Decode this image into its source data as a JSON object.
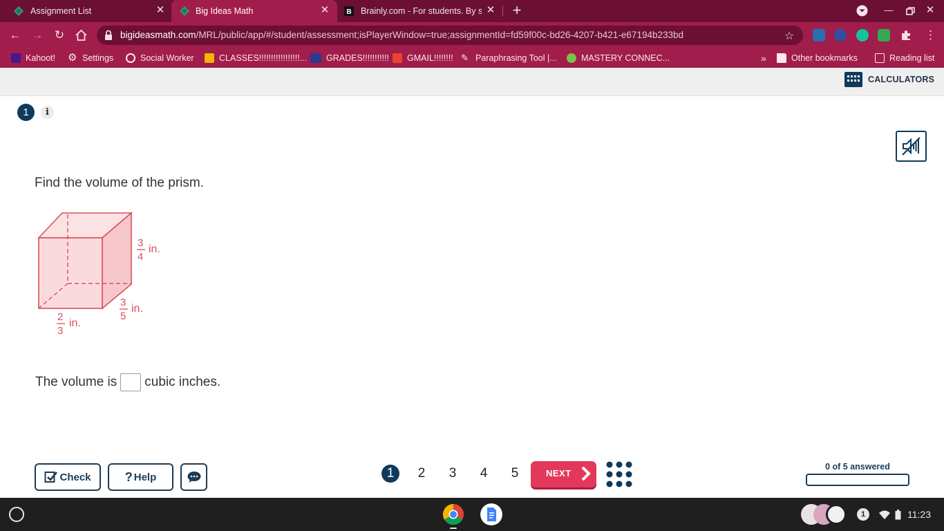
{
  "browser": {
    "tabs": [
      {
        "title": "Assignment List",
        "active": false
      },
      {
        "title": "Big Ideas Math",
        "active": true
      },
      {
        "title": "Brainly.com - For students. By st",
        "active": false
      }
    ],
    "url_host": "bigideasmath.com",
    "url_path": "/MRL/public/app/#/student/assessment;isPlayerWindow=true;assignmentId=fd59f00c-bd26-4207-b421-e67194b233bd",
    "bookmarks": [
      "Kahoot!",
      "Settings",
      "Social Worker",
      "CLASSES!!!!!!!!!!!!!!!!!...",
      "GRADES!!!!!!!!!!!",
      "GMAIL!!!!!!!!",
      "Paraphrasing Tool |...",
      "MASTERY CONNEC..."
    ],
    "other_bookmarks": "Other bookmarks",
    "reading_list": "Reading list",
    "overflow": "»"
  },
  "header": {
    "calculators_label": "CALCULATORS"
  },
  "question": {
    "number": "1",
    "info": "i",
    "prompt": "Find the volume of the prism.",
    "dims": {
      "height": {
        "num": "3",
        "den": "4",
        "unit": "in."
      },
      "depth": {
        "num": "3",
        "den": "5",
        "unit": "in."
      },
      "width": {
        "num": "2",
        "den": "3",
        "unit": "in."
      }
    },
    "answer_prefix": "The volume is",
    "answer_suffix": "cubic inches.",
    "answer_value": ""
  },
  "controls": {
    "check_label": "Check",
    "help_label": "Help",
    "pages": [
      "1",
      "2",
      "3",
      "4",
      "5"
    ],
    "current_page": "1",
    "next_label": "NEXT",
    "progress_label": "0 of 5 answered",
    "progress_fraction": 0
  },
  "shelf": {
    "notification_count": "1",
    "time": "11:23"
  },
  "colors": {
    "brand_dark": "#0e3a5c",
    "next_red": "#e4385a",
    "prism_stroke": "#d9505e",
    "prism_fill": "#f9d7d9",
    "chrome_tab_bg": "#6b0f33",
    "chrome_toolbar": "#a11d4b"
  }
}
